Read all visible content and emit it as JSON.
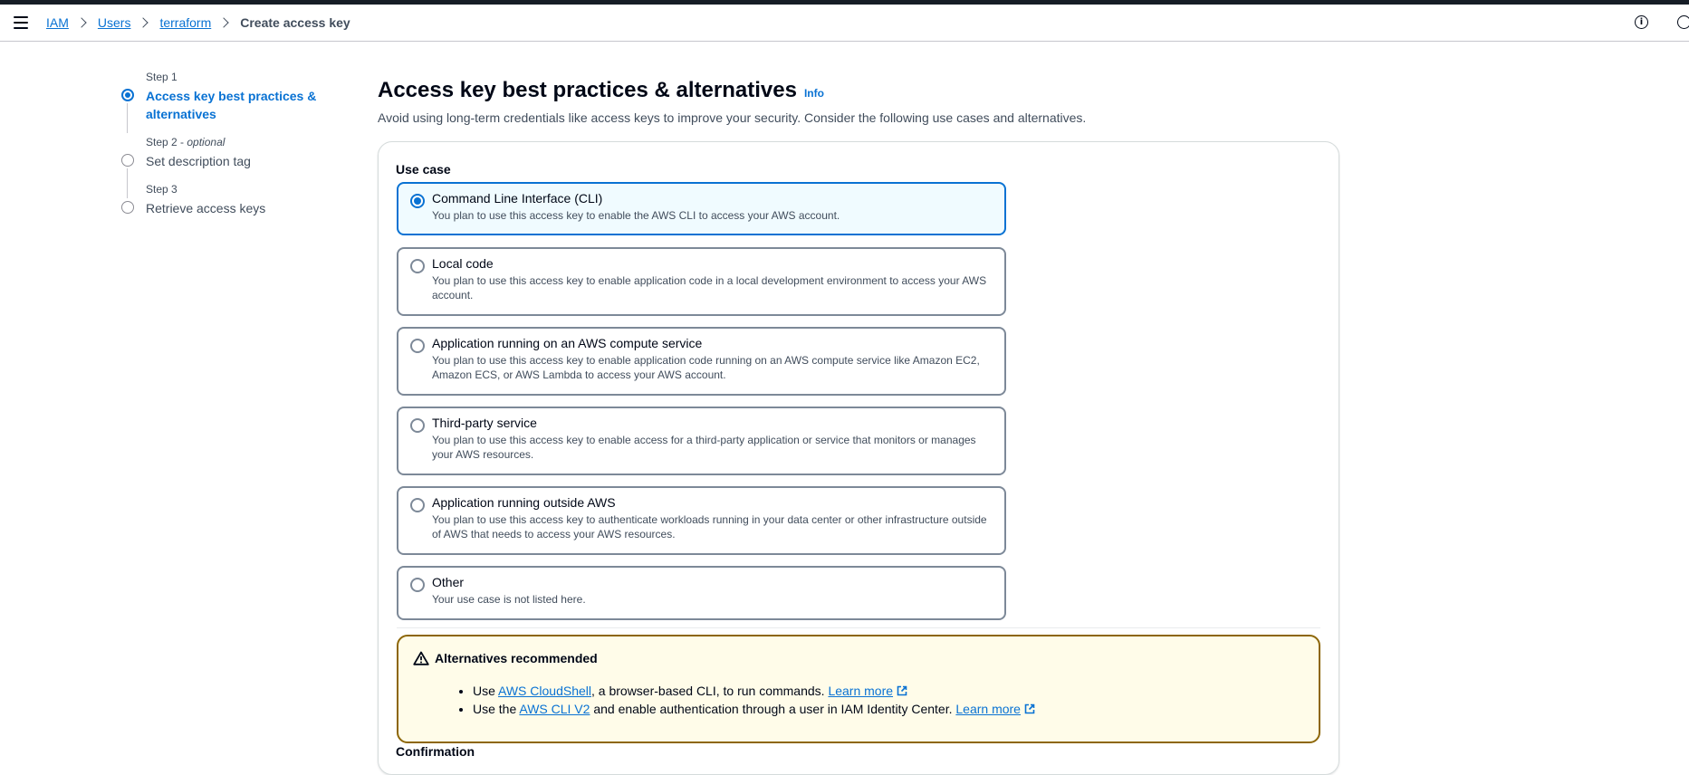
{
  "breadcrumb": {
    "items": [
      "IAM",
      "Users",
      "terraform"
    ],
    "current": "Create access key"
  },
  "steps": [
    {
      "num": "Step 1",
      "optional": "",
      "title": "Access key best practices & alternatives"
    },
    {
      "num": "Step 2",
      "optional": "optional",
      "title": "Set description tag"
    },
    {
      "num": "Step 3",
      "optional": "",
      "title": "Retrieve access keys"
    }
  ],
  "page": {
    "title": "Access key best practices & alternatives",
    "info_link": "Info",
    "description": "Avoid using long-term credentials like access keys to improve your security. Consider the following use cases and alternatives."
  },
  "use_case": {
    "label": "Use case",
    "options": [
      {
        "title": "Command Line Interface (CLI)",
        "desc": "You plan to use this access key to enable the AWS CLI to access your AWS account.",
        "selected": true
      },
      {
        "title": "Local code",
        "desc": "You plan to use this access key to enable application code in a local development environment to access your AWS account.",
        "selected": false
      },
      {
        "title": "Application running on an AWS compute service",
        "desc": "You plan to use this access key to enable application code running on an AWS compute service like Amazon EC2, Amazon ECS, or AWS Lambda to access your AWS account.",
        "selected": false
      },
      {
        "title": "Third-party service",
        "desc": "You plan to use this access key to enable access for a third-party application or service that monitors or manages your AWS resources.",
        "selected": false
      },
      {
        "title": "Application running outside AWS",
        "desc": "You plan to use this access key to authenticate workloads running in your data center or other infrastructure outside of AWS that needs to access your AWS resources.",
        "selected": false
      },
      {
        "title": "Other",
        "desc": "Your use case is not listed here.",
        "selected": false
      }
    ]
  },
  "alert": {
    "title": "Alternatives recommended",
    "items": [
      {
        "prefix": "Use ",
        "link": "AWS CloudShell",
        "middle": ", a browser-based CLI, to run commands. ",
        "learn_more": "Learn more"
      },
      {
        "prefix": "Use the ",
        "link": "AWS CLI V2",
        "middle": " and enable authentication through a user in IAM Identity Center. ",
        "learn_more": "Learn more"
      }
    ]
  },
  "confirmation": {
    "label": "Confirmation"
  },
  "colors": {
    "accent": "#0972d3",
    "warning_border": "#8d6605",
    "warning_bg": "#fffce9",
    "selected_bg": "#f0fbff"
  }
}
